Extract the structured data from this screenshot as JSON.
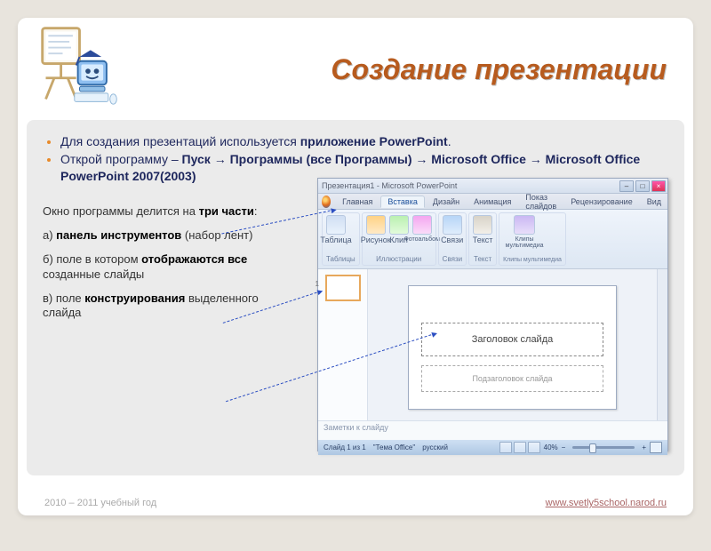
{
  "page_title": "Создание презентации",
  "bullets": {
    "b1_prefix": "Для создания презентаций используется ",
    "b1_bold": "приложение PowerPoint",
    "b1_suffix": ".",
    "b2_prefix": "Открой программу – ",
    "b2_bold": "Пуск → Программы (все Программы) → Microsoft Office → Microsoft Office PowerPoint 2007(2003)"
  },
  "paragraph": {
    "intro_pre": "Окно программы делится на ",
    "intro_bold": "три части",
    "intro_post": ":",
    "a_pre": "а) ",
    "a_bold": "панель инструментов",
    "a_post": " (набор лент)",
    "b_pre": "б) поле в котором ",
    "b_bold": "отображаются все",
    "b_post": " созданные слайды",
    "c_pre": "в) поле ",
    "c_bold": "конструирования",
    "c_post": " выделенного слайда"
  },
  "ppt": {
    "window_title": "Презентация1 - Microsoft PowerPoint",
    "tabs": [
      "Главная",
      "Вставка",
      "Дизайн",
      "Анимация",
      "Показ слайдов",
      "Рецензирование",
      "Вид"
    ],
    "groups": {
      "g1_label": "Таблицы",
      "g1_icon": "Таблица",
      "g2_label": "Иллюстрации",
      "g2_icons": [
        "Рисунок",
        "Клип",
        "Фотоальбом"
      ],
      "g3_label": "Связи",
      "g3_icon": "Связи",
      "g4_label": "Текст",
      "g4_icon": "Текст",
      "g5_label": "Клипы мультимедиа",
      "g5_icon": "Клипы мультимедиа"
    },
    "slide_title_placeholder": "Заголовок слайда",
    "slide_sub_placeholder": "Подзаголовок слайда",
    "notes_placeholder": "Заметки к слайду",
    "status": {
      "left1": "Слайд 1 из 1",
      "left2": "\"Тема Office\"",
      "left3": "русский",
      "zoom": "40%"
    },
    "thumb_number": "1"
  },
  "footer": {
    "year": "2010 – 2011 учебный год",
    "link": "www.svetly5school.narod.ru"
  }
}
